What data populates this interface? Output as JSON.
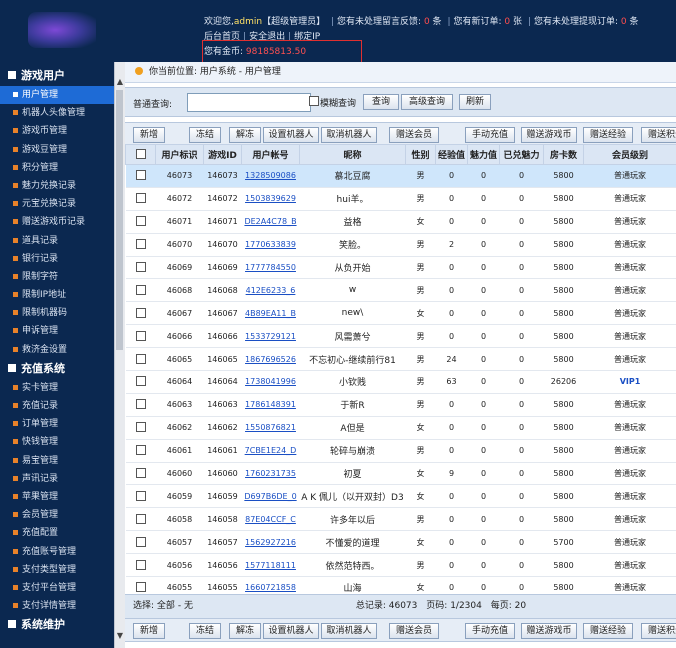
{
  "header": {
    "welcome_prefix": "欢迎您,",
    "user": "admin",
    "role": "【超级管理员】",
    "msg1_pre": "您有未处理留言反馈:",
    "msg1_count": "0",
    "msg1_unit": "条",
    "msg2_pre": "您有新订单:",
    "msg2_count": "0",
    "msg2_unit": "张",
    "msg3_pre": "您有未处理提现订单:",
    "msg3_count": "0",
    "msg3_unit": "条",
    "link_home": "后台首页",
    "link_logout": "安全退出",
    "link_bind": "绑定IP",
    "coin_label": "您有金币:",
    "coin_value": "98185813.50"
  },
  "sidebar": {
    "sections": [
      {
        "title": "游戏用户",
        "items": [
          "用户管理",
          "机器人头像管理",
          "游戏币管理",
          "游戏豆管理",
          "积分管理",
          "魅力兑换记录",
          "元宝兑换记录",
          "赠送游戏币记录",
          "道具记录",
          "银行记录",
          "限制字符",
          "限制IP地址",
          "限制机器码",
          "申诉管理",
          "救济金设置"
        ]
      },
      {
        "title": "充值系统",
        "items": [
          "实卡管理",
          "充值记录",
          "订单管理",
          "快钱管理",
          "易宝管理",
          "声讯记录",
          "苹果管理",
          "会员管理",
          "充值配置",
          "充值账号管理",
          "支付类型管理",
          "支付平台管理",
          "支付详情管理"
        ]
      },
      {
        "title": "系统维护",
        "items": []
      }
    ],
    "active_item": "用户管理"
  },
  "breadcrumb": {
    "text": "你当前位置: 用户系统 - 用户管理"
  },
  "search": {
    "label": "普通查询:",
    "input_value": "",
    "fuzzy_label": "模糊查询",
    "btn_query": "查询",
    "btn_advanced": "高级查询",
    "btn_refresh": "刷新"
  },
  "toolbar": {
    "buttons": [
      "新增",
      "冻结",
      "解冻",
      "设置机器人",
      "取消机器人",
      "赠送会员",
      "手动充值",
      "赠送游戏币",
      "赠送经验",
      "赠送积分"
    ]
  },
  "table": {
    "headers": [
      "",
      "用户标识",
      "游戏ID",
      "用户帐号",
      "昵称",
      "性别",
      "经验值",
      "魅力值",
      "已兑魅力",
      "房卡数",
      "会员级别"
    ],
    "rows": [
      [
        "46073",
        "146073",
        "1328509086",
        "慕北豆腐",
        "男",
        "0",
        "0",
        "0",
        "5800",
        "普通玩家"
      ],
      [
        "46072",
        "146072",
        "1503839629",
        "hui羊。",
        "男",
        "0",
        "0",
        "0",
        "5800",
        "普通玩家"
      ],
      [
        "46071",
        "146071",
        "DE2A4C78_B",
        "益格",
        "女",
        "0",
        "0",
        "0",
        "5800",
        "普通玩家"
      ],
      [
        "46070",
        "146070",
        "1770633839",
        "笑脸。",
        "男",
        "2",
        "0",
        "0",
        "5800",
        "普通玩家"
      ],
      [
        "46069",
        "146069",
        "1777784550",
        "从负开始",
        "男",
        "0",
        "0",
        "0",
        "5800",
        "普通玩家"
      ],
      [
        "46068",
        "146068",
        "412E6233_6",
        "w",
        "男",
        "0",
        "0",
        "0",
        "5800",
        "普通玩家"
      ],
      [
        "46067",
        "146067",
        "4B89EA11_B",
        "new\\",
        "女",
        "0",
        "0",
        "0",
        "5800",
        "普通玩家"
      ],
      [
        "46066",
        "146066",
        "1533729121",
        "风需萧兮",
        "男",
        "0",
        "0",
        "0",
        "5800",
        "普通玩家"
      ],
      [
        "46065",
        "146065",
        "1867696526",
        "不忘初心-继续前行81",
        "男",
        "24",
        "0",
        "0",
        "5800",
        "普通玩家"
      ],
      [
        "46064",
        "146064",
        "1738041996",
        "小钦贱",
        "男",
        "63",
        "0",
        "0",
        "26206",
        "VIP1"
      ],
      [
        "46063",
        "146063",
        "1786148391",
        "于新R",
        "男",
        "0",
        "0",
        "0",
        "5800",
        "普通玩家"
      ],
      [
        "46062",
        "146062",
        "1550876821",
        "A但是",
        "女",
        "0",
        "0",
        "0",
        "5800",
        "普通玩家"
      ],
      [
        "46061",
        "146061",
        "7CBE1E24_D",
        "轮碎与崩溃",
        "男",
        "0",
        "0",
        "0",
        "5800",
        "普通玩家"
      ],
      [
        "46060",
        "146060",
        "1760231735",
        "初夏",
        "女",
        "9",
        "0",
        "0",
        "5800",
        "普通玩家"
      ],
      [
        "46059",
        "146059",
        "D697B6DE_0",
        "A K 佩儿（以开双封）D3",
        "女",
        "0",
        "0",
        "0",
        "5800",
        "普通玩家"
      ],
      [
        "46058",
        "146058",
        "87E04CCF_C",
        "许多年以后",
        "男",
        "0",
        "0",
        "0",
        "5800",
        "普通玩家"
      ],
      [
        "46057",
        "146057",
        "1562927216",
        "不懂爱的道理",
        "女",
        "0",
        "0",
        "0",
        "5700",
        "普通玩家"
      ],
      [
        "46056",
        "146056",
        "1577118111",
        "依然范特西。",
        "男",
        "0",
        "0",
        "0",
        "5800",
        "普通玩家"
      ],
      [
        "46055",
        "146055",
        "1660721858",
        "山海",
        "女",
        "0",
        "0",
        "0",
        "5800",
        "普通玩家"
      ]
    ],
    "selected_row": 0
  },
  "status": {
    "select_label": "选择:",
    "select_all": "全部",
    "select_sep": "-",
    "select_none": "无",
    "total_label": "总记录:",
    "total": "46073",
    "page_label": "页码:",
    "page": "1/2304",
    "per_page_label": "每页:",
    "per_page": "20"
  }
}
